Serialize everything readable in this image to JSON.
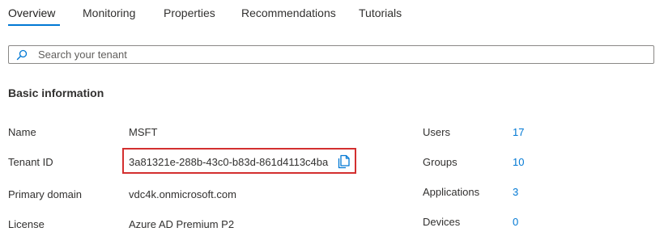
{
  "tabs": [
    {
      "label": "Overview",
      "active": true
    },
    {
      "label": "Monitoring",
      "active": false
    },
    {
      "label": "Properties",
      "active": false
    },
    {
      "label": "Recommendations",
      "active": false
    },
    {
      "label": "Tutorials",
      "active": false
    }
  ],
  "search": {
    "placeholder": "Search your tenant",
    "value": ""
  },
  "basic_info": {
    "title": "Basic information",
    "name_label": "Name",
    "name_value": "MSFT",
    "tenant_label": "Tenant ID",
    "tenant_value": "3a81321e-288b-43c0-b83d-861d4113c4ba",
    "domain_label": "Primary domain",
    "domain_value": "vdc4k.onmicrosoft.com",
    "license_label": "License",
    "license_value": "Azure AD Premium P2"
  },
  "stats": {
    "users_label": "Users",
    "users_value": "17",
    "groups_label": "Groups",
    "groups_value": "10",
    "apps_label": "Applications",
    "apps_value": "3",
    "devices_label": "Devices",
    "devices_value": "0"
  },
  "icons": {
    "search": "search-icon",
    "copy": "copy-icon"
  },
  "colors": {
    "accent": "#0078d4",
    "highlight": "#d32f2f",
    "text": "#323130"
  }
}
